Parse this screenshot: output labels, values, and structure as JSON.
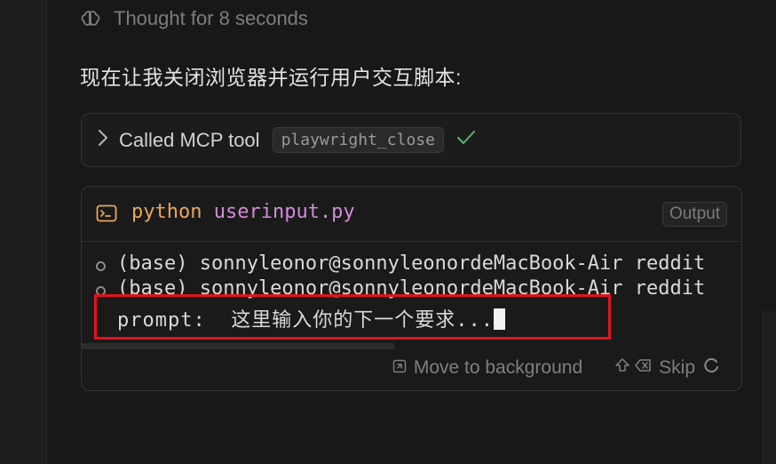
{
  "thought": {
    "icon": "brain-icon",
    "text": "Thought for 8 seconds"
  },
  "message": "现在让我关闭浏览器并运行用户交互脚本:",
  "tool_call": {
    "label": "Called MCP tool",
    "tool_name": "playwright_close",
    "status_icon": "check-icon",
    "status_color": "#5bb46a"
  },
  "terminal": {
    "command_bin": "python",
    "command_arg": "userinput.py",
    "output_label": "Output",
    "lines": [
      "(base) sonnyleonor@sonnyleonordeMacBook-Air reddit",
      "(base) sonnyleonor@sonnyleonordeMacBook-Air reddit"
    ],
    "prompt": "prompt:  这里输入你的下一个要求...",
    "highlight_color": "#e0141b",
    "footer": {
      "move_background": "Move to background",
      "skip": "Skip"
    }
  }
}
